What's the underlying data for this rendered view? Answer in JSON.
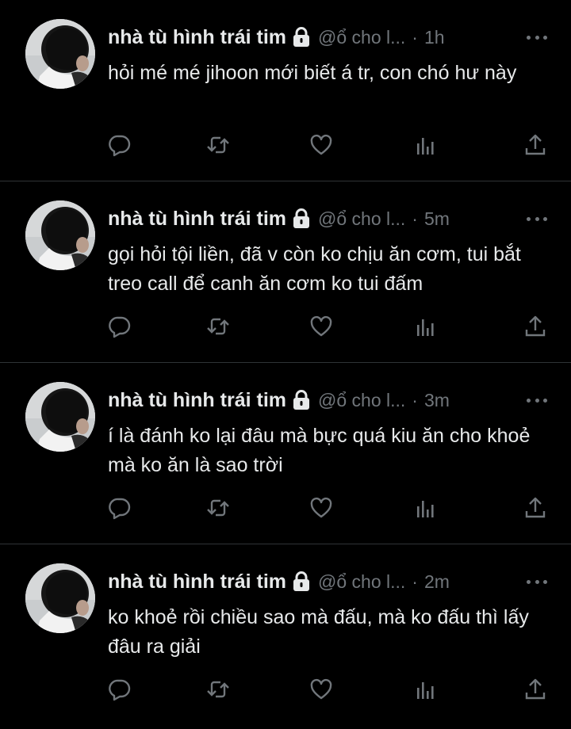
{
  "colors": {
    "background": "#000000",
    "text": "#e7e9ea",
    "muted": "#71767b",
    "divider": "#2f3336"
  },
  "tweets": [
    {
      "name": "nhà tù hình trái tim",
      "handle": "@ổ cho l...",
      "separator": "·",
      "time": "1h",
      "text": "hỏi mé mé jihoon mới biết á tr, con chó hư này"
    },
    {
      "name": "nhà tù hình trái tim",
      "handle": "@ổ cho l...",
      "separator": "·",
      "time": "5m",
      "text": "gọi hỏi tội liền, đã v còn ko chịu ăn cơm, tui bắt treo call để canh ăn cơm ko tui đấm"
    },
    {
      "name": "nhà tù hình trái tim",
      "handle": "@ổ cho l...",
      "separator": "·",
      "time": "3m",
      "text": "í là đánh ko lại đâu mà bực quá kiu ăn cho khoẻ mà ko ăn là sao trời"
    },
    {
      "name": "nhà tù hình trái tim",
      "handle": "@ổ cho l...",
      "separator": "·",
      "time": "2m",
      "text": "ko khoẻ rồi chiều sao mà đấu, mà ko đấu thì lấy đâu ra giải"
    }
  ],
  "icons": {
    "protected": "lock-icon",
    "reply": "reply-icon",
    "retweet": "retweet-icon",
    "like": "heart-icon",
    "views": "analytics-icon",
    "share": "share-icon",
    "more": "more-icon"
  }
}
